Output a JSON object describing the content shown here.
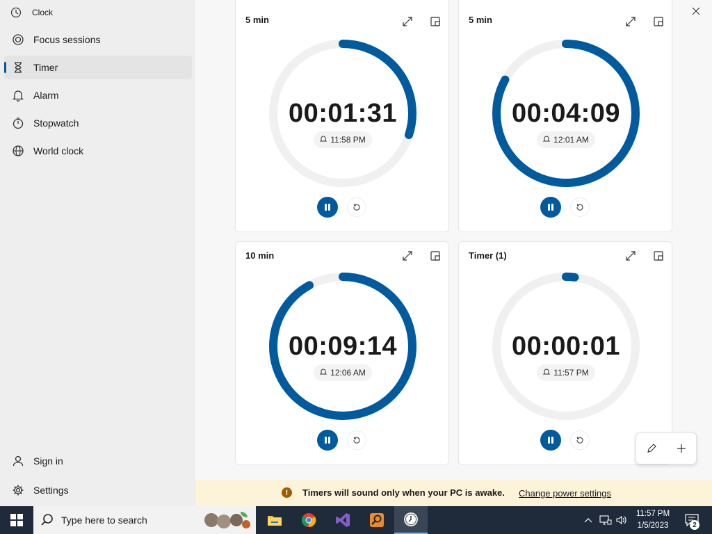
{
  "app": {
    "title": "Clock"
  },
  "sidebar": {
    "items": [
      {
        "label": "Focus sessions"
      },
      {
        "label": "Timer"
      },
      {
        "label": "Alarm"
      },
      {
        "label": "Stopwatch"
      },
      {
        "label": "World clock"
      }
    ],
    "bottom": [
      {
        "label": "Sign in"
      },
      {
        "label": "Settings"
      }
    ]
  },
  "timers": [
    {
      "title": "5 min",
      "time": "00:01:31",
      "alarm": "11:58 PM",
      "progress": 0.3
    },
    {
      "title": "5 min",
      "time": "00:04:09",
      "alarm": "12:01 AM",
      "progress": 0.83
    },
    {
      "title": "10 min",
      "time": "00:09:14",
      "alarm": "12:06 AM",
      "progress": 0.92
    },
    {
      "title": "Timer (1)",
      "time": "00:00:01",
      "alarm": "11:57 PM",
      "progress": 0.02
    }
  ],
  "banner": {
    "message": "Timers will sound only when your PC is awake.",
    "link": "Change power settings"
  },
  "taskbar": {
    "search_placeholder": "Type here to search",
    "time": "11:57 PM",
    "date": "1/5/2023",
    "notification_count": "2"
  },
  "colors": {
    "accent": "#005a9e",
    "track": "#f0f0f0",
    "banner": "#fcf3d8",
    "taskbar": "#1f2b3a"
  }
}
